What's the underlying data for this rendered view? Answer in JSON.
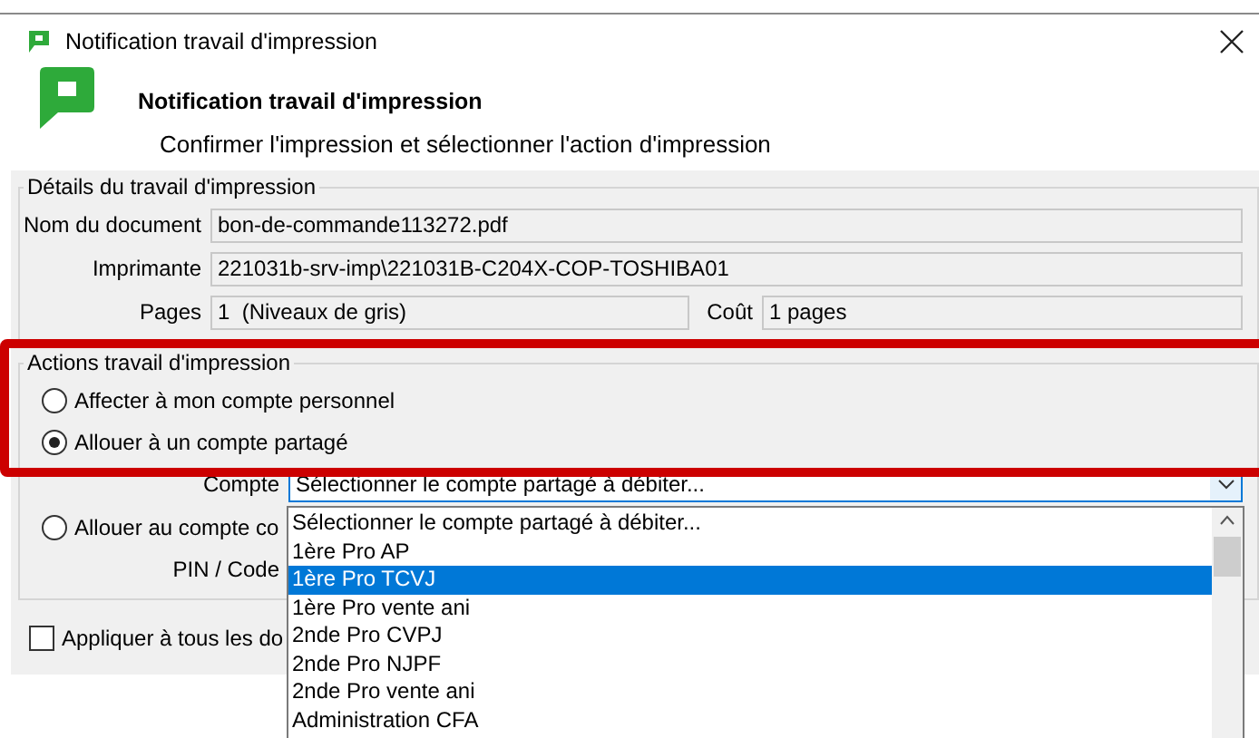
{
  "window": {
    "title": "Notification travail d'impression"
  },
  "header": {
    "title": "Notification travail d'impression",
    "subtitle": "Confirmer l'impression et sélectionner l'action d'impression"
  },
  "details": {
    "legend": "Détails du travail d'impression",
    "fields": [
      {
        "label": "Nom du document",
        "value": "bon-de-commande113272.pdf"
      },
      {
        "label": "Imprimante",
        "value": "221031b-srv-imp\\221031B-C204X-COP-TOSHIBA01"
      }
    ],
    "pages": {
      "label": "Pages",
      "value": "1  (Niveaux de gris)"
    },
    "cost": {
      "label": "Coût",
      "value": "1 pages"
    }
  },
  "actions": {
    "legend": "Actions travail d'impression",
    "options": [
      {
        "label": "Affecter à mon compte personnel",
        "selected": false
      },
      {
        "label": "Allouer à un compte partagé",
        "selected": true
      },
      {
        "label": "Allouer au compte co",
        "selected": false
      }
    ],
    "account": {
      "label": "Compte",
      "value": "Sélectionner le compte partagé à débiter...",
      "expanded": true
    },
    "pin": {
      "label": "PIN / Code"
    }
  },
  "dropdown": {
    "items": [
      {
        "label": "Sélectionner le compte partagé à débiter...",
        "selected": false
      },
      {
        "label": "1ère Pro AP",
        "selected": false
      },
      {
        "label": "1ère Pro TCVJ",
        "selected": true
      },
      {
        "label": "1ère Pro vente ani",
        "selected": false
      },
      {
        "label": "2nde Pro CVPJ",
        "selected": false
      },
      {
        "label": "2nde Pro NJPF",
        "selected": false
      },
      {
        "label": "2nde Pro vente ani",
        "selected": false
      },
      {
        "label": "Administration CFA",
        "selected": false
      }
    ]
  },
  "apply_all": {
    "label": "Appliquer à tous les do",
    "checked": false
  }
}
